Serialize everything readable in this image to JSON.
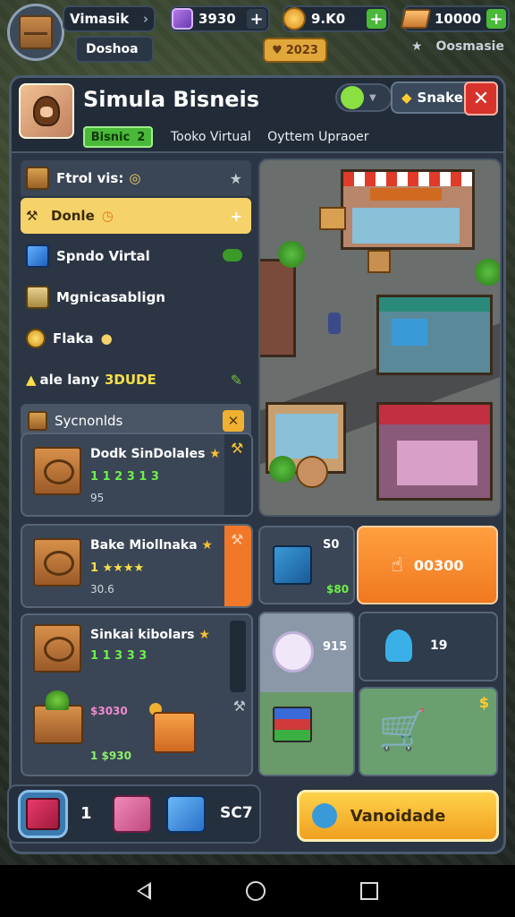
{
  "topbar": {
    "player_name": "Vimasik",
    "player_sub": "Doshoa",
    "gems": "3930",
    "coins": "9.K0",
    "gold": "10000",
    "gold_tag": "2023",
    "notif_label": "Oosmasie"
  },
  "header": {
    "title": "Simula Bisneis",
    "shake_label": "Snake",
    "tab_active": "Bisnic",
    "tab_active_count": "2",
    "subtabs": [
      "Tooko Virtual",
      "Oyttem Upraoer"
    ]
  },
  "left_list": {
    "head": "Ftrol vis:",
    "selected": "Donle",
    "items": [
      {
        "label": "Spndo Virtal"
      },
      {
        "label": "Mgnicasablign"
      },
      {
        "label": "Flaka"
      },
      {
        "label": "ale lany",
        "badge": "3DUDE"
      }
    ],
    "section": "Sycnonlds"
  },
  "cards": [
    {
      "name": "Dodk SinDolales",
      "stars": "1 1 2 3 1 3",
      "sub": "95"
    },
    {
      "name": "Bake Miollnaka",
      "stars": "1 ★★★★",
      "sub": "30.6"
    },
    {
      "name": "Sinkai kibolars",
      "stars": "1 1 3 3 3",
      "sub": "1 $930",
      "extra": "$3030"
    }
  ],
  "right_widgets": {
    "truck_count": "S0",
    "truck_price": "$80",
    "order_value": "00300",
    "timer_value": "915",
    "staff_value": "19"
  },
  "bottom": {
    "count_a": "1",
    "count_b": "SC7",
    "sell_label": "Vanoidade"
  },
  "colors": {
    "panel": "#2b3543",
    "accent_yellow": "#f6d36a",
    "accent_green": "#4ab838",
    "accent_orange": "#f07820",
    "close_red": "#d8322c"
  }
}
